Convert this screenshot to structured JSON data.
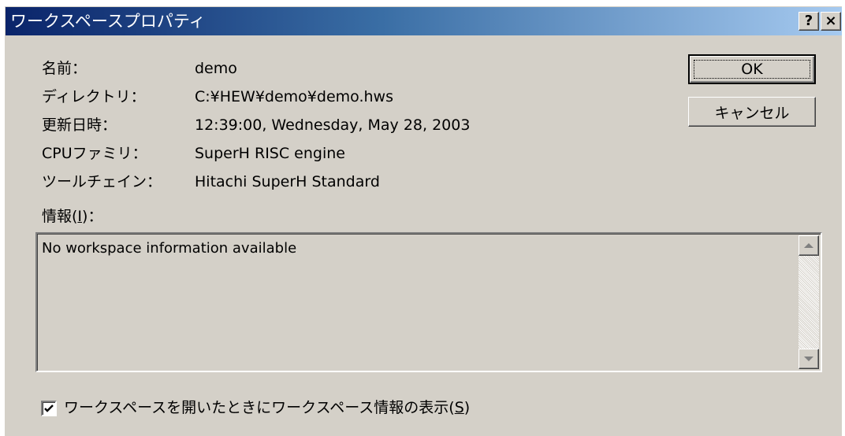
{
  "window": {
    "title": "ワークスペースプロパティ",
    "help_button": "?",
    "close_button": "×"
  },
  "properties": [
    {
      "label": "名前：",
      "value": "demo"
    },
    {
      "label": "ディレクトリ：",
      "value": "C:¥HEW¥demo¥demo.hws"
    },
    {
      "label": "更新日時：",
      "value": "12:39:00, Wednesday, May 28, 2003"
    },
    {
      "label": "CPUファミリ：",
      "value": "SuperH RISC engine"
    },
    {
      "label": "ツールチェイン：",
      "value": "Hitachi SuperH Standard"
    }
  ],
  "buttons": {
    "ok": "OK",
    "cancel": "キャンセル"
  },
  "info": {
    "label_prefix": "情報(",
    "label_mnemonic": "I",
    "label_suffix": ")：",
    "text": "No workspace information available"
  },
  "checkbox": {
    "checked": true,
    "label_prefix": "ワークスペースを開いたときにワークスペース情報の表示(",
    "label_mnemonic": "S",
    "label_suffix": ")"
  }
}
